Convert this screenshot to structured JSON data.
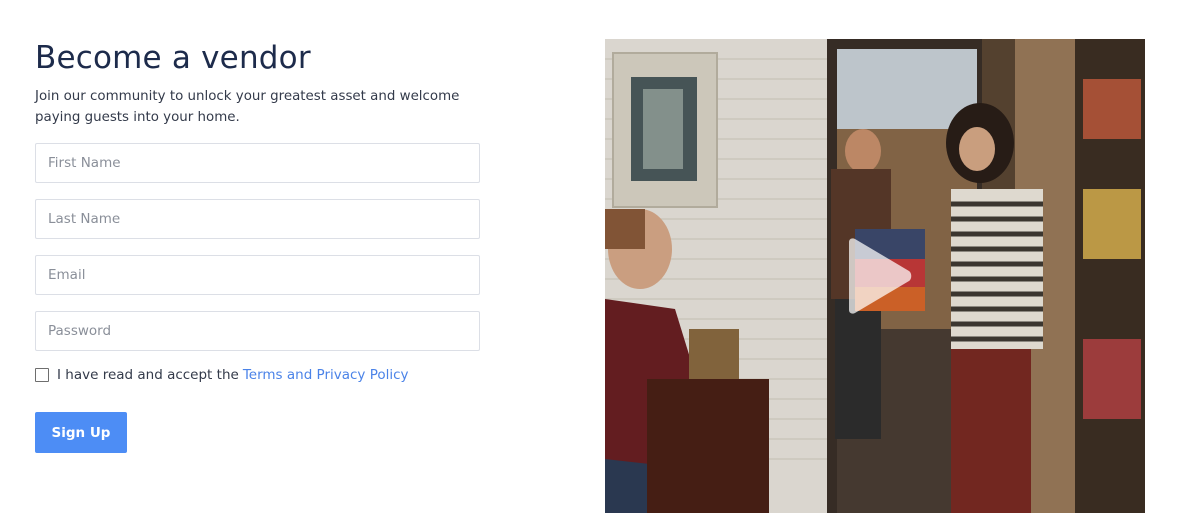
{
  "header": {
    "title": "Become a vendor",
    "subtitle": "Join our community to unlock your greatest asset and welcome paying guests into your home."
  },
  "form": {
    "first_name_placeholder": "First Name",
    "last_name_placeholder": "Last Name",
    "email_placeholder": "Email",
    "password_placeholder": "Password",
    "terms_text": "I have read and accept the",
    "terms_link": "Terms and Privacy Policy",
    "terms_checked": false,
    "submit_label": "Sign Up"
  },
  "media": {
    "type": "video",
    "play_icon": "play-icon"
  },
  "colors": {
    "title": "#1d2b4b",
    "accent": "#4d8df5",
    "link": "#4b83e8",
    "input_border": "#dcdfe6"
  }
}
